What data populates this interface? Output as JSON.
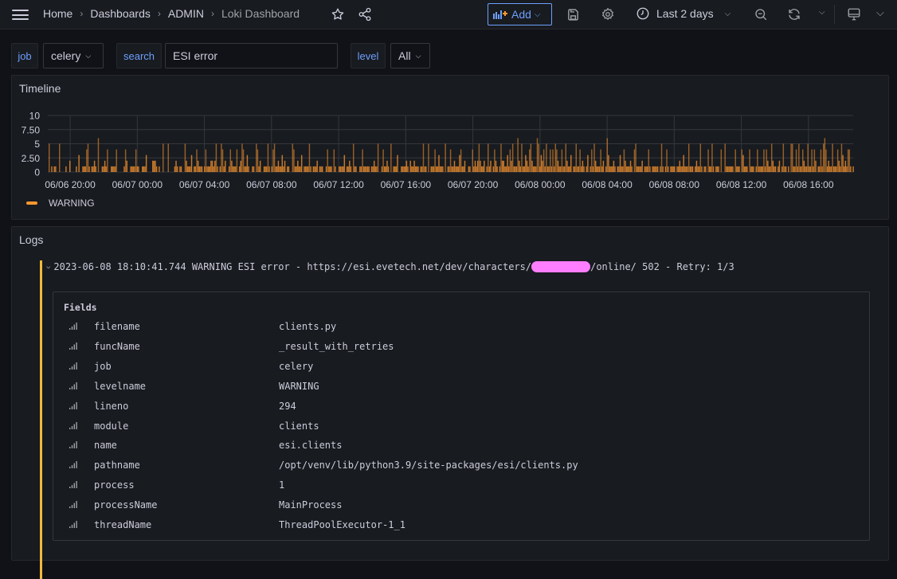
{
  "header": {
    "breadcrumb": [
      "Home",
      "Dashboards",
      "ADMIN",
      "Loki Dashboard"
    ],
    "add_label": "Add",
    "time_range": "Last 2 days",
    "icons": [
      "menu-icon",
      "star-icon",
      "share-icon",
      "add-panel-icon",
      "save-icon",
      "settings-icon",
      "clock-icon",
      "zoom-out-icon",
      "refresh-icon",
      "tv-mode-icon"
    ]
  },
  "variables": {
    "job": {
      "label": "job",
      "value": "celery"
    },
    "search": {
      "label": "search",
      "value": "ESI error",
      "placeholder": ""
    },
    "level": {
      "label": "level",
      "value": "All"
    }
  },
  "timeline": {
    "title": "Timeline",
    "legend": [
      {
        "label": "WARNING",
        "color": "#ff9830"
      }
    ]
  },
  "chart_data": {
    "type": "bar",
    "title": "Timeline",
    "xlabel": "",
    "ylabel": "",
    "ylim": [
      0,
      10
    ],
    "y_ticks": [
      "0",
      "2.50",
      "5",
      "7.50",
      "10"
    ],
    "x_ticks": [
      "06/06 20:00",
      "06/07 00:00",
      "06/07 04:00",
      "06/07 08:00",
      "06/07 12:00",
      "06/07 16:00",
      "06/07 20:00",
      "06/08 00:00",
      "06/08 04:00",
      "06/08 08:00",
      "06/08 12:00",
      "06/08 16:00"
    ],
    "x_range": [
      "06/06 18:40",
      "06/08 18:40"
    ],
    "grid": true,
    "legend_position": "bottom-left",
    "series": [
      {
        "name": "WARNING",
        "color": "#ff9830",
        "values": [
          5,
          0,
          1,
          0,
          1,
          1,
          0,
          0,
          5,
          0,
          0,
          0,
          0,
          1,
          0,
          0,
          2,
          0,
          0,
          0,
          0,
          1,
          0,
          3,
          0,
          0,
          1,
          1,
          1,
          4,
          5,
          1,
          0,
          1,
          1,
          2,
          1,
          0,
          6,
          0,
          0,
          1,
          1,
          2,
          1,
          4,
          0,
          0,
          1,
          1,
          1,
          1,
          4,
          0,
          0,
          0,
          0,
          0,
          1,
          4,
          2,
          0,
          0,
          1,
          1,
          1,
          1,
          4,
          1,
          1,
          0,
          0,
          1,
          1,
          1,
          3,
          0,
          0,
          0,
          0,
          2,
          2,
          2,
          1,
          0,
          1,
          0,
          0,
          5,
          0,
          0,
          0,
          5,
          0,
          0,
          0,
          0,
          1,
          2,
          1,
          0,
          1,
          1,
          0,
          0,
          5,
          2,
          1,
          1,
          1,
          3,
          0,
          1,
          1,
          4,
          2,
          1,
          1,
          1,
          0,
          1,
          4,
          1,
          1,
          1,
          2,
          2,
          1,
          2,
          5,
          1,
          0,
          1,
          5,
          4,
          1,
          2,
          0,
          0,
          1,
          4,
          2,
          1,
          1,
          1,
          4,
          0,
          1,
          2,
          5,
          4,
          1,
          1,
          3,
          1,
          0,
          0,
          1,
          1,
          0,
          5,
          4,
          1,
          2,
          0,
          0,
          1,
          1,
          1,
          5,
          1,
          0,
          1,
          4,
          5,
          1,
          1,
          2,
          1,
          1,
          3,
          1,
          2,
          0,
          1,
          1,
          0,
          0,
          5,
          4,
          1,
          1,
          2,
          1,
          1,
          3,
          0,
          1,
          1,
          1,
          1,
          5,
          1,
          0,
          1,
          1,
          1,
          2,
          0,
          1,
          1,
          1,
          0,
          0,
          1,
          4,
          1,
          1,
          1,
          0,
          4,
          1,
          0,
          0,
          1,
          1,
          1,
          1,
          3,
          0,
          1,
          1,
          2,
          1,
          0,
          5,
          1,
          1,
          0,
          0,
          1,
          1,
          4,
          1,
          1,
          1,
          1,
          1,
          0,
          1,
          1,
          2,
          1,
          1,
          5,
          0,
          0,
          1,
          4,
          1,
          1,
          2,
          1,
          0,
          5,
          0,
          1,
          1,
          1,
          3,
          0,
          0,
          1,
          1,
          1,
          1,
          2,
          1,
          0,
          2,
          1,
          1,
          2,
          1,
          1,
          1,
          0,
          1,
          1,
          5,
          1,
          1,
          0,
          5,
          0,
          1,
          1,
          1,
          4,
          1,
          1,
          3,
          1,
          1,
          1,
          0,
          5,
          0,
          1,
          1,
          4,
          1,
          1,
          2,
          1,
          1,
          1,
          3,
          4,
          1,
          1,
          2,
          0,
          0,
          1,
          1,
          0,
          4,
          1,
          2,
          1,
          2,
          5,
          2,
          1,
          1,
          2,
          0,
          1,
          5,
          1,
          2,
          0,
          1,
          4,
          2,
          1,
          0,
          1,
          5,
          2,
          2,
          1,
          1,
          3,
          1,
          4,
          2,
          5,
          1,
          1,
          1,
          6,
          2,
          1,
          5,
          1,
          1,
          3,
          2,
          1,
          4,
          5,
          2,
          1,
          1,
          1,
          6,
          5,
          1,
          3,
          2,
          4,
          1,
          5,
          1,
          1,
          4,
          1,
          4,
          1,
          5,
          4,
          2,
          1,
          1,
          4,
          1,
          1,
          5,
          2,
          1,
          1,
          3,
          0,
          1,
          1,
          5,
          1,
          1,
          4,
          1,
          2,
          1,
          0,
          1,
          3,
          0,
          1,
          4,
          1,
          5,
          2,
          1,
          1,
          1,
          4,
          1,
          2,
          0,
          1,
          6,
          3,
          1,
          1,
          1,
          2,
          1,
          0,
          1,
          1,
          3,
          1,
          1,
          4,
          2,
          1,
          1,
          1,
          2,
          1,
          0,
          4,
          5,
          1,
          1,
          1,
          1,
          2,
          0,
          1,
          1,
          1,
          4,
          1,
          0,
          1,
          1,
          1,
          1,
          1,
          0,
          1,
          5,
          1,
          0,
          1,
          4,
          1,
          0,
          1,
          1,
          1,
          1,
          0,
          1,
          1,
          2,
          1,
          1,
          3,
          1,
          1,
          1,
          5,
          1,
          1,
          1,
          0,
          1,
          2,
          1,
          1,
          5,
          1,
          0,
          1,
          1,
          0,
          4,
          1,
          1,
          5,
          1,
          0,
          1,
          1,
          1,
          0,
          4,
          0,
          0,
          5,
          1,
          1,
          1,
          1,
          1,
          1,
          0,
          4,
          1,
          1,
          1,
          0,
          4,
          3,
          1,
          1,
          1,
          0,
          4,
          1,
          1,
          1,
          0,
          1,
          4,
          1,
          1,
          1,
          1,
          4,
          1,
          4,
          2,
          1,
          1,
          5,
          2,
          1,
          1,
          0,
          1,
          2,
          0,
          1,
          5,
          1,
          1,
          0,
          1,
          0,
          5,
          5,
          1,
          1,
          4,
          1,
          5,
          1,
          1,
          4,
          2,
          1,
          1,
          5,
          1,
          1,
          4,
          1,
          4,
          2,
          0,
          1,
          1,
          4,
          1,
          5,
          6,
          4,
          1,
          2,
          1,
          1,
          5,
          1,
          1,
          1,
          4,
          2,
          1,
          5,
          3,
          1,
          2,
          1,
          4,
          4,
          1,
          0,
          1
        ]
      }
    ]
  },
  "logs": {
    "title": "Logs",
    "entry": {
      "timestamp": "2023-06-08 18:10:41.744",
      "level": "WARNING",
      "message_prefix": "ESI error - https://esi.evetech.net/dev/characters/",
      "message_redacted": "[redacted]",
      "message_suffix": "/online/ 502 - Retry: 1/3",
      "level_color": "#f2b93d"
    },
    "fields_title": "Fields",
    "fields": [
      {
        "key": "filename",
        "value": "clients.py"
      },
      {
        "key": "funcName",
        "value": "_result_with_retries"
      },
      {
        "key": "job",
        "value": "celery"
      },
      {
        "key": "levelname",
        "value": "WARNING"
      },
      {
        "key": "lineno",
        "value": "294"
      },
      {
        "key": "module",
        "value": "clients"
      },
      {
        "key": "name",
        "value": "esi.clients"
      },
      {
        "key": "pathname",
        "value": "/opt/venv/lib/python3.9/site-packages/esi/clients.py"
      },
      {
        "key": "process",
        "value": "1"
      },
      {
        "key": "processName",
        "value": "MainProcess"
      },
      {
        "key": "threadName",
        "value": "ThreadPoolExecutor-1_1"
      }
    ]
  }
}
